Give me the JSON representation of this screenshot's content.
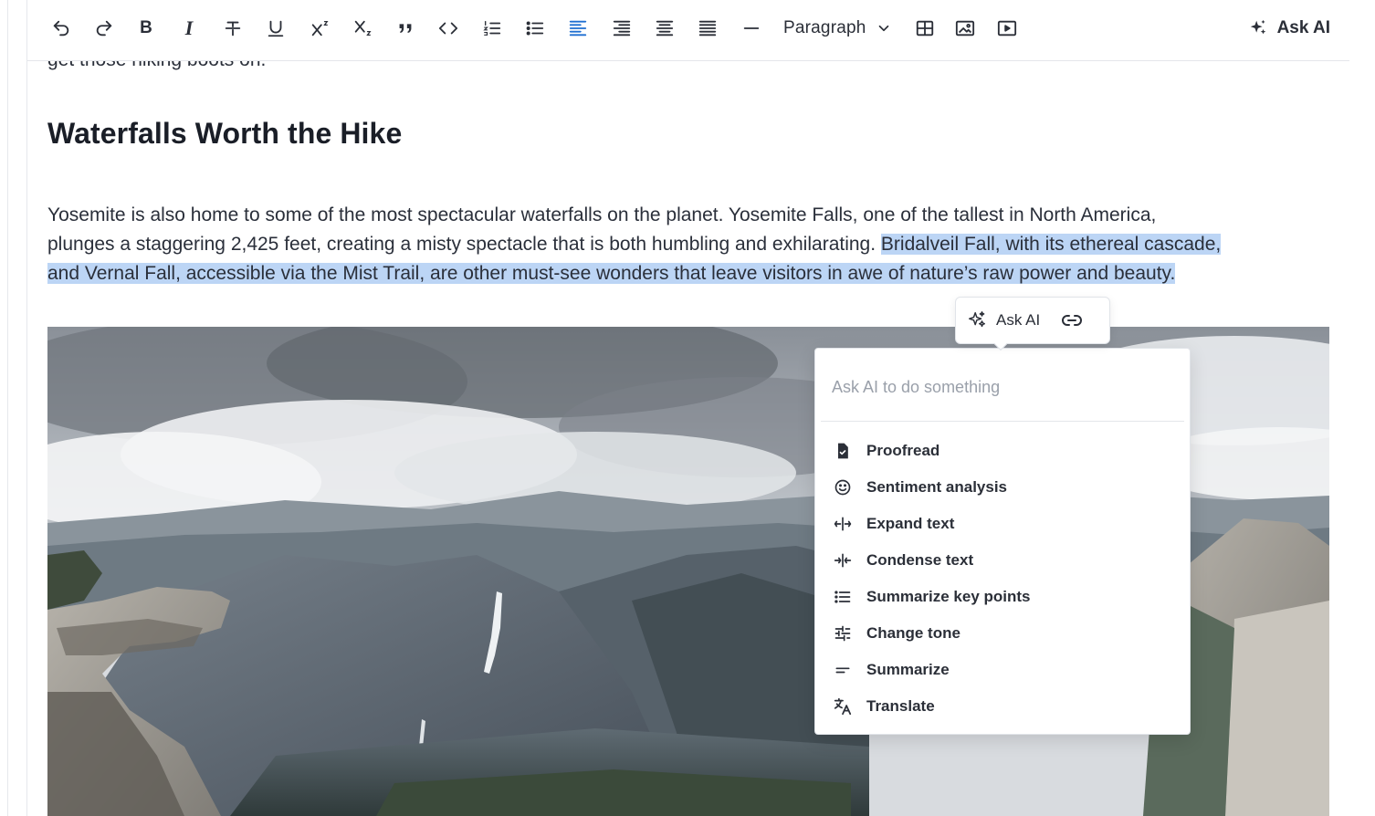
{
  "toolbar": {
    "undo_icon": "undo-icon",
    "redo_icon": "redo-icon",
    "bold": "B",
    "italic": "I",
    "block_style": "Paragraph",
    "ask_ai": "Ask AI"
  },
  "content": {
    "cut_text": "get those hiking boots on.",
    "heading": "Waterfalls Worth the Hike",
    "para_line1": "Yosemite is also home to some of the most spectacular waterfalls on the planet. Yosemite Falls, one of the tallest in North America,",
    "para_line2_plain": "plunges a staggering 2,425 feet, creating a misty spectacle that is both humbling and exhilarating. ",
    "para_line2_selected": "Bridalveil Fall, with its ethereal cascade,",
    "para_line3_selected": "and Vernal Fall, accessible via the Mist Trail, are other must-see wonders that leave visitors in awe of nature’s raw power and beauty."
  },
  "bubble": {
    "ask_ai": "Ask AI"
  },
  "ai_menu": {
    "placeholder": "Ask AI to do something",
    "items": [
      {
        "label": "Proofread",
        "icon": "file-check-icon"
      },
      {
        "label": "Sentiment analysis",
        "icon": "smiley-icon"
      },
      {
        "label": "Expand text",
        "icon": "expand-icon"
      },
      {
        "label": "Condense text",
        "icon": "condense-icon"
      },
      {
        "label": "Summarize key points",
        "icon": "list-icon"
      },
      {
        "label": "Change tone",
        "icon": "sliders-icon"
      },
      {
        "label": "Summarize",
        "icon": "summarize-icon"
      },
      {
        "label": "Translate",
        "icon": "translate-icon"
      }
    ]
  },
  "colors": {
    "accent": "#1f6fd1",
    "selection": "#bcd5f5",
    "text": "#2a2f3a"
  }
}
